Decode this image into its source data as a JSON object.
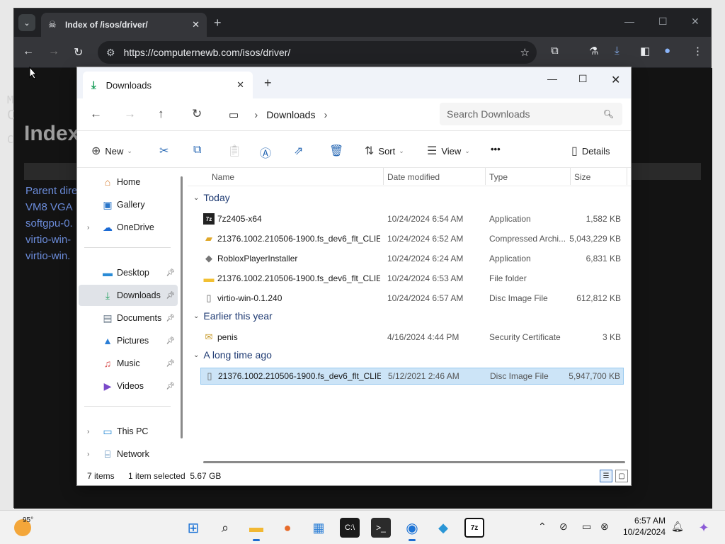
{
  "browser": {
    "tab_title": "Index of /isos/driver/",
    "url": "https://computernewb.com/isos/driver/"
  },
  "web_page": {
    "heading": "Index",
    "side_letters": [
      "M",
      "C",
      "C"
    ],
    "links": [
      "Parent dire",
      "VM8 VGA",
      "softgpu-0.",
      "virtio-win-",
      "virtio-win."
    ]
  },
  "explorer": {
    "tab_title": "Downloads",
    "path": [
      "Downloads"
    ],
    "search_placeholder": "Search Downloads",
    "commands": {
      "new": "New",
      "sort": "Sort",
      "view": "View",
      "more": "•••",
      "details": "Details"
    },
    "sidebar": [
      {
        "label": "Home",
        "icon": "home-icon"
      },
      {
        "label": "Gallery",
        "icon": "gallery-icon"
      },
      {
        "label": "OneDrive",
        "icon": "cloud-icon"
      },
      {
        "label": "Desktop",
        "icon": "desktop-icon"
      },
      {
        "label": "Downloads",
        "icon": "download-icon"
      },
      {
        "label": "Documents",
        "icon": "document-icon"
      },
      {
        "label": "Pictures",
        "icon": "pictures-icon"
      },
      {
        "label": "Music",
        "icon": "music-icon"
      },
      {
        "label": "Videos",
        "icon": "videos-icon"
      },
      {
        "label": "This PC",
        "icon": "computer-icon"
      },
      {
        "label": "Network",
        "icon": "network-icon"
      }
    ],
    "columns": [
      "Name",
      "Date modified",
      "Type",
      "Size"
    ],
    "groups": [
      {
        "label": "Today",
        "files": [
          {
            "name": "7z2405-x64",
            "date": "10/24/2024 6:54 AM",
            "type": "Application",
            "size": "1,582 KB",
            "icon": "7zip-icon"
          },
          {
            "name": "21376.1002.210506-1900.fs_dev6_flt_CLIE...",
            "date": "10/24/2024 6:52 AM",
            "type": "Compressed Archi...",
            "size": "5,043,229 KB",
            "icon": "archive-icon"
          },
          {
            "name": "RobloxPlayerInstaller",
            "date": "10/24/2024 6:24 AM",
            "type": "Application",
            "size": "6,831 KB",
            "icon": "roblox-icon"
          },
          {
            "name": "21376.1002.210506-1900.fs_dev6_flt_CLIE...",
            "date": "10/24/2024 6:53 AM",
            "type": "File folder",
            "size": "",
            "icon": "folder-icon"
          },
          {
            "name": "virtio-win-0.1.240",
            "date": "10/24/2024 6:57 AM",
            "type": "Disc Image File",
            "size": "612,812 KB",
            "icon": "disc-image-icon"
          }
        ]
      },
      {
        "label": "Earlier this year",
        "files": [
          {
            "name": "penis",
            "date": "4/16/2024 4:44 PM",
            "type": "Security Certificate",
            "size": "3 KB",
            "icon": "certificate-icon"
          }
        ]
      },
      {
        "label": "A long time ago",
        "files": [
          {
            "name": "21376.1002.210506-1900.fs_dev6_flt_CLIE...",
            "date": "5/12/2021 2:46 AM",
            "type": "Disc Image File",
            "size": "5,947,700 KB",
            "icon": "disc-image-icon",
            "selected": true
          }
        ]
      }
    ],
    "status": {
      "items": "7 items",
      "selection": "1 item selected  5.67 GB"
    }
  },
  "taskbar": {
    "temperature": "95°",
    "time": "6:57 AM",
    "date": "10/24/2024"
  }
}
